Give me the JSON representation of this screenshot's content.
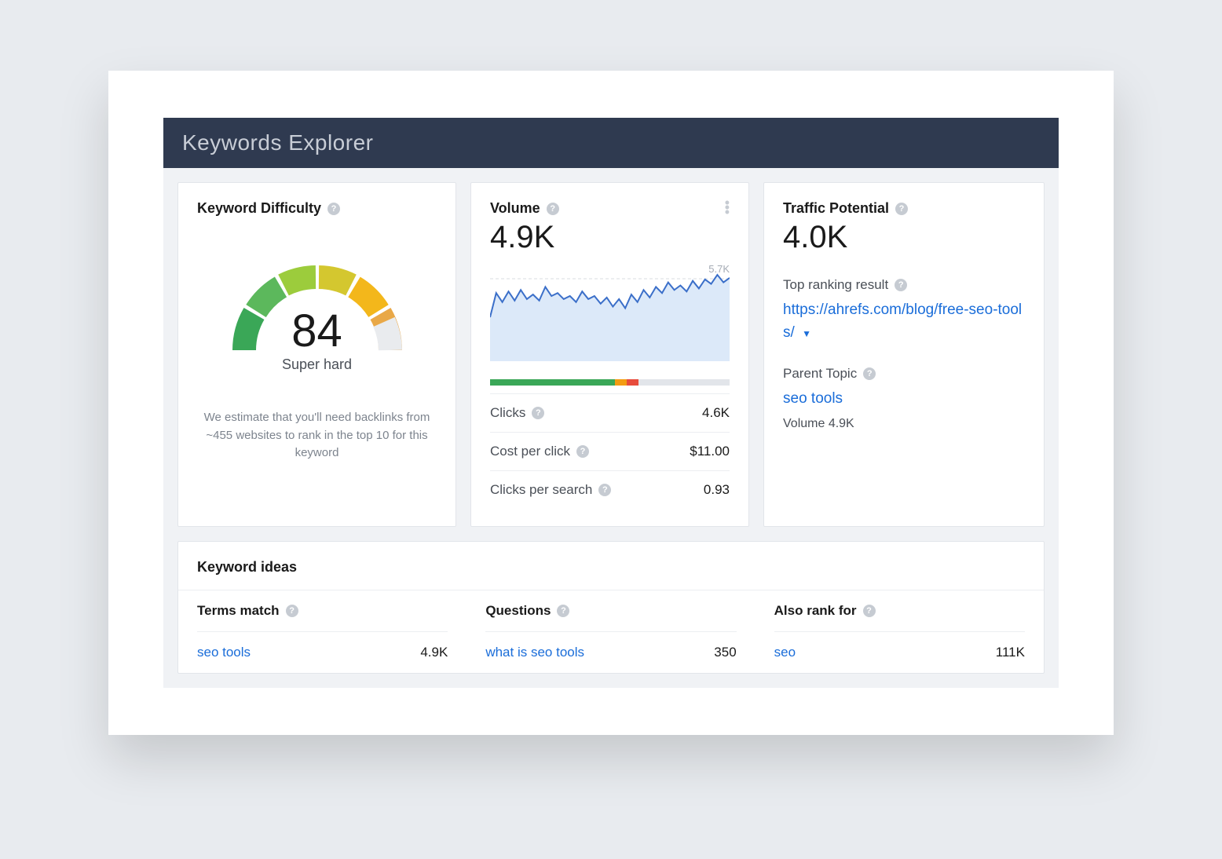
{
  "header": {
    "title": "Keywords Explorer"
  },
  "kd": {
    "title": "Keyword Difficulty",
    "score": "84",
    "score_label": "Super hard",
    "desc": "We estimate that you'll need backlinks from ~455 websites to rank in the top 10 for this keyword"
  },
  "volume": {
    "title": "Volume",
    "value": "4.9K",
    "peak_label": "5.7K",
    "metrics": [
      {
        "label": "Clicks",
        "value": "4.6K"
      },
      {
        "label": "Cost per click",
        "value": "$11.00"
      },
      {
        "label": "Clicks per search",
        "value": "0.93"
      }
    ],
    "segments": [
      {
        "color": "#3aa757",
        "pct": 52
      },
      {
        "color": "#f39c12",
        "pct": 5
      },
      {
        "color": "#e74c3c",
        "pct": 5
      },
      {
        "color": "#e2e5ea",
        "pct": 38
      }
    ]
  },
  "tp": {
    "title": "Traffic Potential",
    "value": "4.0K",
    "top_ranking_label": "Top ranking result",
    "top_ranking_url": "https://ahrefs.com/blog/free-seo-tools/",
    "parent_topic_label": "Parent Topic",
    "parent_topic": "seo tools",
    "parent_volume": "Volume 4.9K"
  },
  "ideas": {
    "title": "Keyword ideas",
    "cols": [
      {
        "head": "Terms match",
        "kw": "seo tools",
        "val": "4.9K"
      },
      {
        "head": "Questions",
        "kw": "what is seo tools",
        "val": "350"
      },
      {
        "head": "Also rank for",
        "kw": "seo",
        "val": "111K"
      }
    ]
  },
  "chart_data": {
    "type": "line",
    "title": "Volume trend",
    "ylim": [
      0,
      5700
    ],
    "peak": 5700,
    "values": [
      2900,
      4500,
      3900,
      4600,
      4000,
      4700,
      4100,
      4400,
      4000,
      4900,
      4300,
      4500,
      4100,
      4300,
      3900,
      4600,
      4100,
      4300,
      3800,
      4200,
      3600,
      4100,
      3500,
      4400,
      3900,
      4700,
      4200,
      4900,
      4500,
      5200,
      4700,
      5000,
      4600,
      5300,
      4800,
      5400,
      5100,
      5700,
      5200,
      5500
    ]
  }
}
